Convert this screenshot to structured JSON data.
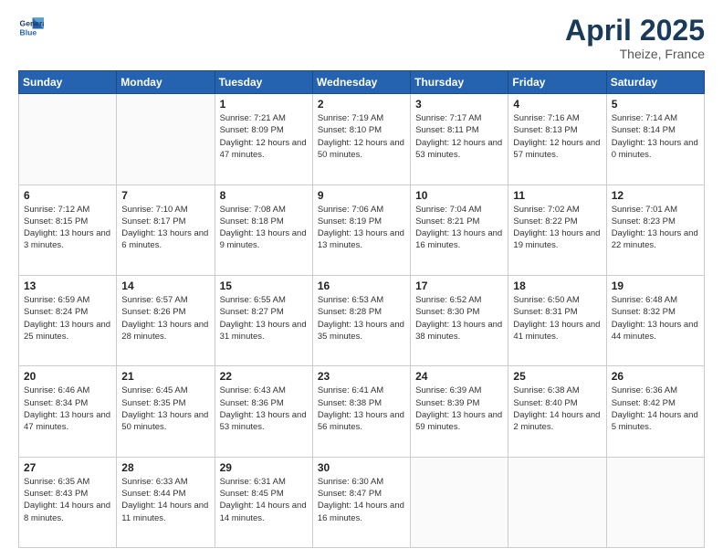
{
  "header": {
    "logo_line1": "General",
    "logo_line2": "Blue",
    "title": "April 2025",
    "location": "Theize, France"
  },
  "days_of_week": [
    "Sunday",
    "Monday",
    "Tuesday",
    "Wednesday",
    "Thursday",
    "Friday",
    "Saturday"
  ],
  "weeks": [
    [
      {
        "day": "",
        "info": ""
      },
      {
        "day": "",
        "info": ""
      },
      {
        "day": "1",
        "info": "Sunrise: 7:21 AM\nSunset: 8:09 PM\nDaylight: 12 hours and 47 minutes."
      },
      {
        "day": "2",
        "info": "Sunrise: 7:19 AM\nSunset: 8:10 PM\nDaylight: 12 hours and 50 minutes."
      },
      {
        "day": "3",
        "info": "Sunrise: 7:17 AM\nSunset: 8:11 PM\nDaylight: 12 hours and 53 minutes."
      },
      {
        "day": "4",
        "info": "Sunrise: 7:16 AM\nSunset: 8:13 PM\nDaylight: 12 hours and 57 minutes."
      },
      {
        "day": "5",
        "info": "Sunrise: 7:14 AM\nSunset: 8:14 PM\nDaylight: 13 hours and 0 minutes."
      }
    ],
    [
      {
        "day": "6",
        "info": "Sunrise: 7:12 AM\nSunset: 8:15 PM\nDaylight: 13 hours and 3 minutes."
      },
      {
        "day": "7",
        "info": "Sunrise: 7:10 AM\nSunset: 8:17 PM\nDaylight: 13 hours and 6 minutes."
      },
      {
        "day": "8",
        "info": "Sunrise: 7:08 AM\nSunset: 8:18 PM\nDaylight: 13 hours and 9 minutes."
      },
      {
        "day": "9",
        "info": "Sunrise: 7:06 AM\nSunset: 8:19 PM\nDaylight: 13 hours and 13 minutes."
      },
      {
        "day": "10",
        "info": "Sunrise: 7:04 AM\nSunset: 8:21 PM\nDaylight: 13 hours and 16 minutes."
      },
      {
        "day": "11",
        "info": "Sunrise: 7:02 AM\nSunset: 8:22 PM\nDaylight: 13 hours and 19 minutes."
      },
      {
        "day": "12",
        "info": "Sunrise: 7:01 AM\nSunset: 8:23 PM\nDaylight: 13 hours and 22 minutes."
      }
    ],
    [
      {
        "day": "13",
        "info": "Sunrise: 6:59 AM\nSunset: 8:24 PM\nDaylight: 13 hours and 25 minutes."
      },
      {
        "day": "14",
        "info": "Sunrise: 6:57 AM\nSunset: 8:26 PM\nDaylight: 13 hours and 28 minutes."
      },
      {
        "day": "15",
        "info": "Sunrise: 6:55 AM\nSunset: 8:27 PM\nDaylight: 13 hours and 31 minutes."
      },
      {
        "day": "16",
        "info": "Sunrise: 6:53 AM\nSunset: 8:28 PM\nDaylight: 13 hours and 35 minutes."
      },
      {
        "day": "17",
        "info": "Sunrise: 6:52 AM\nSunset: 8:30 PM\nDaylight: 13 hours and 38 minutes."
      },
      {
        "day": "18",
        "info": "Sunrise: 6:50 AM\nSunset: 8:31 PM\nDaylight: 13 hours and 41 minutes."
      },
      {
        "day": "19",
        "info": "Sunrise: 6:48 AM\nSunset: 8:32 PM\nDaylight: 13 hours and 44 minutes."
      }
    ],
    [
      {
        "day": "20",
        "info": "Sunrise: 6:46 AM\nSunset: 8:34 PM\nDaylight: 13 hours and 47 minutes."
      },
      {
        "day": "21",
        "info": "Sunrise: 6:45 AM\nSunset: 8:35 PM\nDaylight: 13 hours and 50 minutes."
      },
      {
        "day": "22",
        "info": "Sunrise: 6:43 AM\nSunset: 8:36 PM\nDaylight: 13 hours and 53 minutes."
      },
      {
        "day": "23",
        "info": "Sunrise: 6:41 AM\nSunset: 8:38 PM\nDaylight: 13 hours and 56 minutes."
      },
      {
        "day": "24",
        "info": "Sunrise: 6:39 AM\nSunset: 8:39 PM\nDaylight: 13 hours and 59 minutes."
      },
      {
        "day": "25",
        "info": "Sunrise: 6:38 AM\nSunset: 8:40 PM\nDaylight: 14 hours and 2 minutes."
      },
      {
        "day": "26",
        "info": "Sunrise: 6:36 AM\nSunset: 8:42 PM\nDaylight: 14 hours and 5 minutes."
      }
    ],
    [
      {
        "day": "27",
        "info": "Sunrise: 6:35 AM\nSunset: 8:43 PM\nDaylight: 14 hours and 8 minutes."
      },
      {
        "day": "28",
        "info": "Sunrise: 6:33 AM\nSunset: 8:44 PM\nDaylight: 14 hours and 11 minutes."
      },
      {
        "day": "29",
        "info": "Sunrise: 6:31 AM\nSunset: 8:45 PM\nDaylight: 14 hours and 14 minutes."
      },
      {
        "day": "30",
        "info": "Sunrise: 6:30 AM\nSunset: 8:47 PM\nDaylight: 14 hours and 16 minutes."
      },
      {
        "day": "",
        "info": ""
      },
      {
        "day": "",
        "info": ""
      },
      {
        "day": "",
        "info": ""
      }
    ]
  ]
}
